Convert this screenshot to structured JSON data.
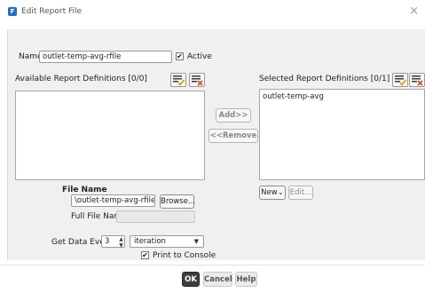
{
  "window": {
    "title": "Edit Report File",
    "icon": "fluent-app-icon"
  },
  "name": {
    "label": "Name",
    "value": "outlet-temp-avg-rfile"
  },
  "active": {
    "label": "Active",
    "checked": true,
    "mark": "✔"
  },
  "available": {
    "label": "Available Report Definitions [0/0]",
    "items": []
  },
  "selected": {
    "label": "Selected Report Definitions [0/1]",
    "items": [
      "outlet-temp-avg"
    ]
  },
  "buttons": {
    "add": "Add>>",
    "remove": "<<Remove",
    "new": "New",
    "new_arrow": "⌄",
    "edit": "Edit...",
    "browse": "Browse...",
    "ok": "OK",
    "cancel": "Cancel",
    "help": "Help"
  },
  "file": {
    "section_label": "File Name",
    "value": "\\outlet-temp-avg-rfile.out",
    "full_label": "Full File Name",
    "full_value": ""
  },
  "get_data": {
    "label": "Get Data Every",
    "value": "3",
    "unit": "iteration",
    "arrows": "▲▼",
    "select_arrow": "▼"
  },
  "print_console": {
    "label": "Print to Console",
    "checked": true,
    "mark": "✔"
  },
  "close_glyph": "×",
  "colors": {
    "accent": "#1f6fc6",
    "panel": "#f0f0f0",
    "select_icon": "#d8a21a",
    "deselect_icon": "#d2541b"
  }
}
